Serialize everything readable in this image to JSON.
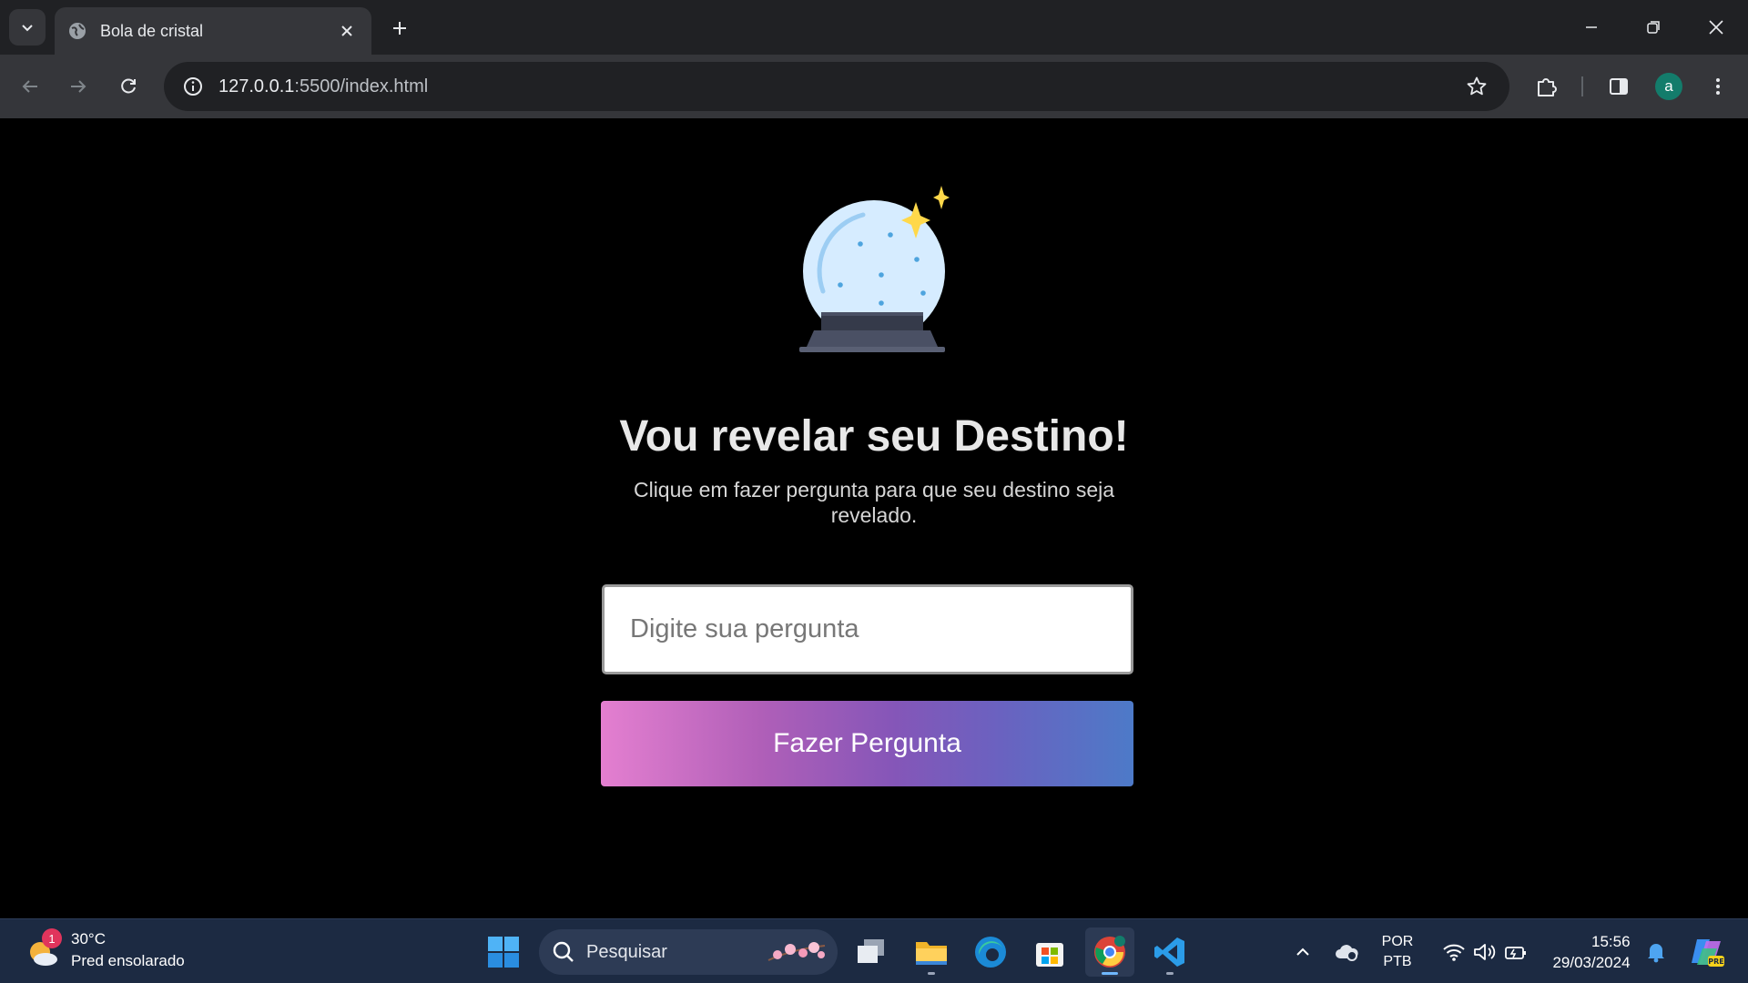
{
  "browser": {
    "tab_title": "Bola de cristal",
    "url_host": "127.0.0.1",
    "url_path": ":5500/index.html",
    "profile_initial": "a"
  },
  "page": {
    "headline": "Vou revelar seu Destino!",
    "subtitle": "Clique em fazer pergunta para que seu destino seja revelado.",
    "question_placeholder": "Digite sua pergunta",
    "question_value": "",
    "button_label": "Fazer Pergunta",
    "button_gradient": [
      "#e47fd0",
      "#8556b8",
      "#4d7ac8"
    ]
  },
  "taskbar": {
    "weather_temp": "30°C",
    "weather_desc": "Pred ensolarado",
    "weather_badge": "1",
    "search_placeholder": "Pesquisar",
    "lang_code": "POR",
    "layout_code": "PTB",
    "time": "15:56",
    "date": "29/03/2024",
    "apps": [
      "task-view",
      "file-explorer",
      "edge",
      "microsoft-store",
      "chrome",
      "vscode"
    ]
  },
  "colors": {
    "page_bg": "#000000",
    "tabbar_bg": "#202124",
    "toolbar_bg": "#35363a",
    "taskbar_bg": "#1c2a42"
  }
}
